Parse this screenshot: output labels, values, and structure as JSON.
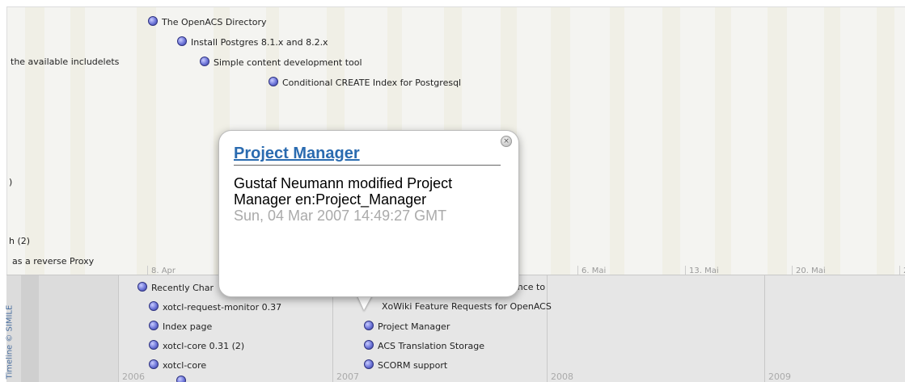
{
  "upper_events": [
    {
      "label": "The OpenACS Directory"
    },
    {
      "label": "Install Postgres 8.1.x and 8.2.x"
    },
    {
      "label": "Simple content development tool"
    },
    {
      "label": "Conditional CREATE Index for Postgresql"
    }
  ],
  "left_clipped": {
    "line1": "the available includelets",
    "line2": ")",
    "line3": "h (2)",
    "line4": "as a reverse Proxy"
  },
  "date_labels": [
    "8. Apr",
    "6. Mai",
    "13. Mai",
    "20. Mai",
    "2"
  ],
  "lower_events_col1": [
    {
      "label": "Recently Char"
    },
    {
      "label": "xotcl-request-monitor 0.37"
    },
    {
      "label": "Index page"
    },
    {
      "label": "xotcl-core 0.31 (2)"
    },
    {
      "label": "xotcl-core"
    }
  ],
  "lower_events_col2": [
    {
      "label": "ance to"
    },
    {
      "label": "XoWiki Feature Requests for OpenACS"
    },
    {
      "label": "Project Manager"
    },
    {
      "label": "ACS Translation Storage"
    },
    {
      "label": "SCORM support"
    }
  ],
  "years": [
    "2006",
    "2007",
    "2008",
    "2009"
  ],
  "credit": "Timeline © SIMILE",
  "popup": {
    "title": "Project Manager",
    "body": "Gustaf Neumann modified Project Manager en:Project_Manager",
    "date": "Sun, 04 Mar 2007 14:49:27 GMT",
    "close_icon": "×"
  }
}
